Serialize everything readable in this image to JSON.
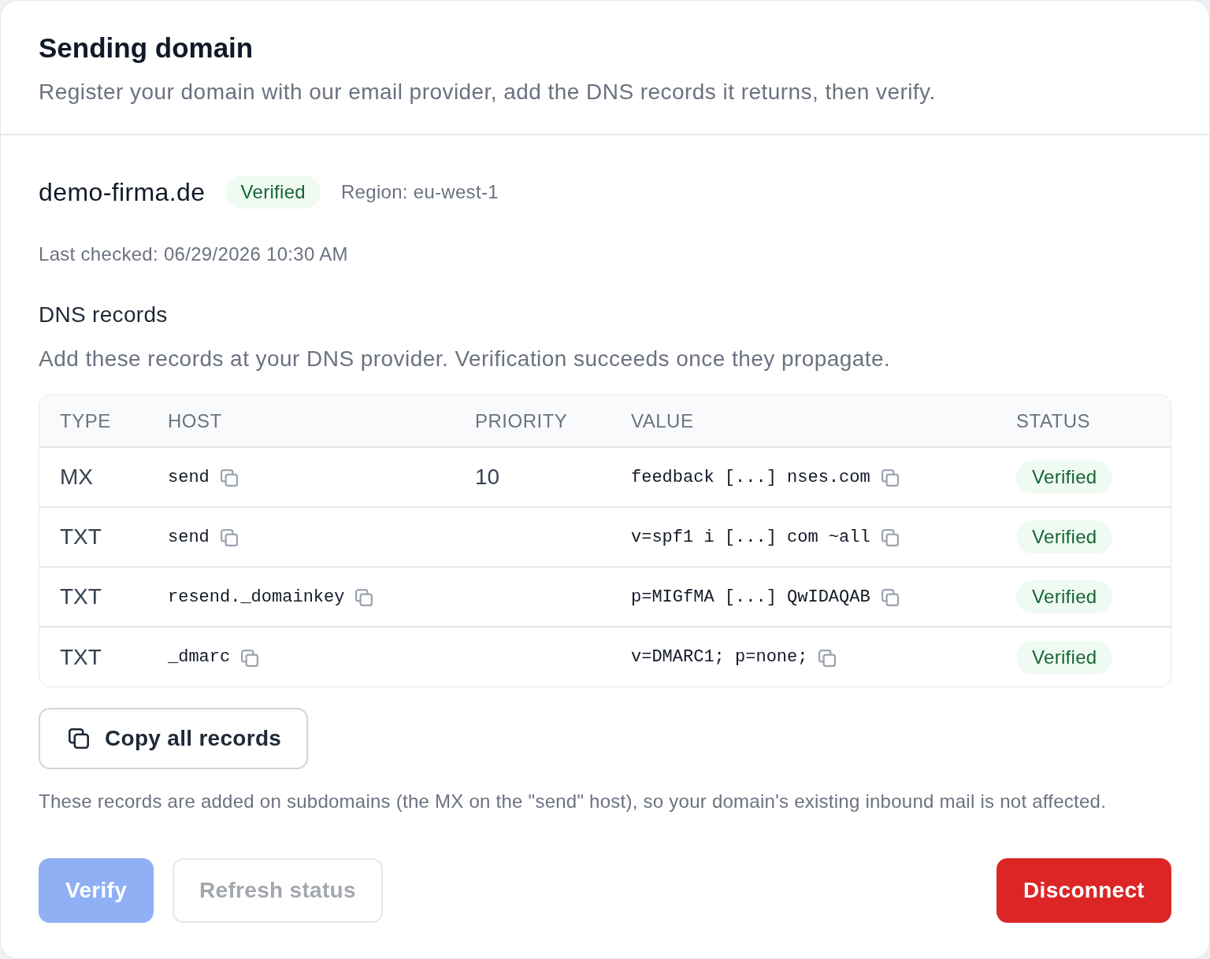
{
  "header": {
    "title": "Sending domain",
    "subtitle": "Register your domain with our email provider, add the DNS records it returns, then verify."
  },
  "domain": {
    "name": "demo-firma.de",
    "status": "Verified",
    "region": "Region: eu-west-1",
    "last_checked": "Last checked: 06/29/2026 10:30 AM"
  },
  "dns": {
    "title": "DNS records",
    "description": "Add these records at your DNS provider. Verification succeeds once they propagate.",
    "table": {
      "columns": [
        "TYPE",
        "HOST",
        "PRIORITY",
        "VALUE",
        "STATUS"
      ],
      "rows": [
        {
          "type": "MX",
          "host": "send",
          "priority": "10",
          "value": "feedback [...] nses.com",
          "status": "Verified"
        },
        {
          "type": "TXT",
          "host": "send",
          "value": "v=spf1 i [...] com ~all",
          "status": "Verified"
        },
        {
          "type": "TXT",
          "host": "resend._domainkey",
          "value": "p=MIGfMA [...] QwIDAQAB",
          "status": "Verified"
        },
        {
          "type": "TXT",
          "host": "_dmarc",
          "value": "v=DMARC1; p=none;",
          "status": "Verified"
        }
      ]
    }
  },
  "copy_button": {
    "label": "Copy all records"
  },
  "note": "These records are added on subdomains (the MX on the \"send\" host), so your domain's existing inbound mail is not affected.",
  "actions": [
    {
      "label": "Verify",
      "kind": "primary",
      "disabled": true
    },
    {
      "label": "Refresh status",
      "kind": "secondary",
      "disabled": true
    },
    {
      "label": "Disconnect",
      "kind": "danger",
      "disabled": false
    }
  ]
}
